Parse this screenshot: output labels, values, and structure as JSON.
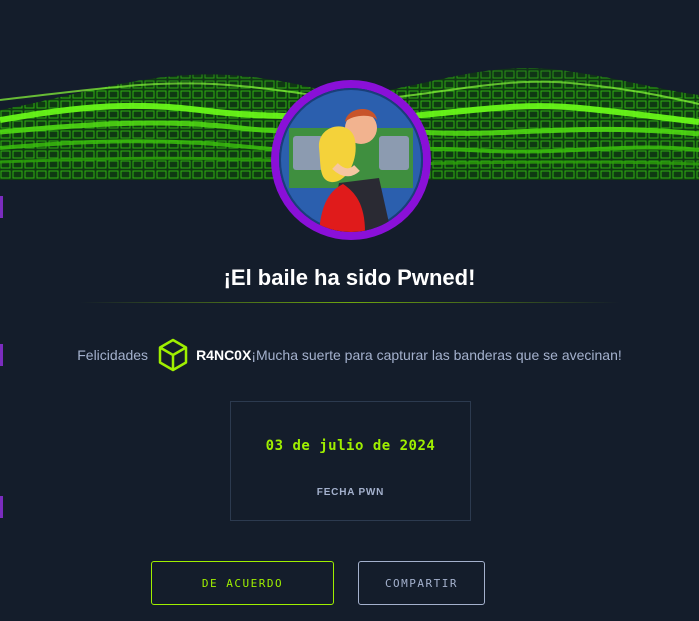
{
  "machine": {
    "title": "¡El baile ha sido Pwned!",
    "avatar_icon": "dancing-couple-avatar"
  },
  "message": {
    "prefix": "Felicidades",
    "user_icon": "hexagon-cube-icon",
    "username": "R4NC0X",
    "suffix": "¡Mucha suerte para capturar las banderas que se avecinan!"
  },
  "pwn_date": {
    "value": "03 de julio de 2024",
    "label": "FECHA PWN"
  },
  "actions": {
    "agree_label": "DE ACUERDO",
    "share_label": "COMPARTIR"
  },
  "colors": {
    "background": "#141d2b",
    "accent_green": "#9fef00",
    "avatar_ring": "#8a10d8",
    "text_muted": "#a4b1cd"
  }
}
